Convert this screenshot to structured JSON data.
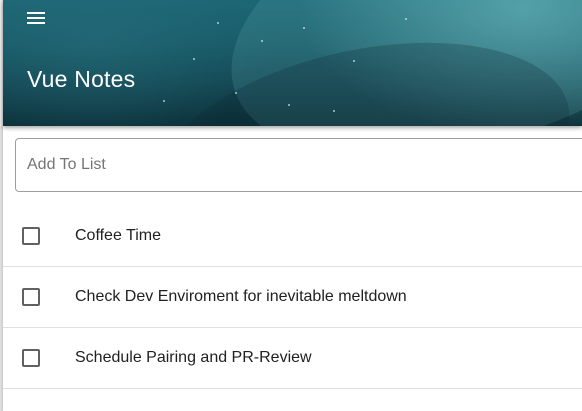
{
  "app": {
    "title": "Vue Notes",
    "menu_icon": "hamburger-menu-icon"
  },
  "add_field": {
    "placeholder": "Add To List",
    "value": ""
  },
  "todos": [
    {
      "text": "Coffee Time",
      "checked": false
    },
    {
      "text": "Check Dev Enviroment for inevitable meltdown",
      "checked": false
    },
    {
      "text": "Schedule Pairing and PR-Review",
      "checked": false
    }
  ],
  "colors": {
    "header_dark": "#0c2f37",
    "header_teal": "#1c6674",
    "divider": "#e0e0e0",
    "checkbox_border": "#616161"
  }
}
